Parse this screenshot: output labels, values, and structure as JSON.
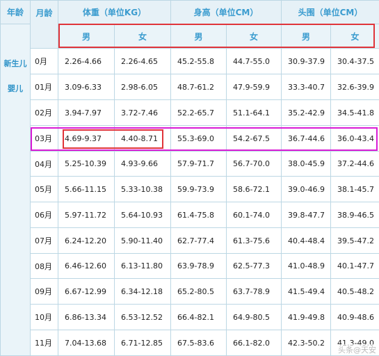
{
  "headers": {
    "age": "年龄",
    "month": "月龄",
    "weight": "体重（单位KG）",
    "height": "身高（单位CM）",
    "head": "头围（单位CM）"
  },
  "gender": {
    "male": "男",
    "female": "女"
  },
  "age_group": {
    "line1": "新生儿",
    "line2": "婴儿"
  },
  "rows": [
    {
      "month": "0月",
      "w_m": "2.26-4.66",
      "w_f": "2.26-4.65",
      "h_m": "45.2-55.8",
      "h_f": "44.7-55.0",
      "c_m": "30.9-37.9",
      "c_f": "30.4-37.5"
    },
    {
      "month": "01月",
      "w_m": "3.09-6.33",
      "w_f": "2.98-6.05",
      "h_m": "48.7-61.2",
      "h_f": "47.9-59.9",
      "c_m": "33.3-40.7",
      "c_f": "32.6-39.9"
    },
    {
      "month": "02月",
      "w_m": "3.94-7.97",
      "w_f": "3.72-7.46",
      "h_m": "52.2-65.7",
      "h_f": "51.1-64.1",
      "c_m": "35.2-42.9",
      "c_f": "34.5-41.8"
    },
    {
      "month": "03月",
      "w_m": "4.69-9.37",
      "w_f": "4.40-8.71",
      "h_m": "55.3-69.0",
      "h_f": "54.2-67.5",
      "c_m": "36.7-44.6",
      "c_f": "36.0-43.4"
    },
    {
      "month": "04月",
      "w_m": "5.25-10.39",
      "w_f": "4.93-9.66",
      "h_m": "57.9-71.7",
      "h_f": "56.7-70.0",
      "c_m": "38.0-45.9",
      "c_f": "37.2-44.6"
    },
    {
      "month": "05月",
      "w_m": "5.66-11.15",
      "w_f": "5.33-10.38",
      "h_m": "59.9-73.9",
      "h_f": "58.6-72.1",
      "c_m": "39.0-46.9",
      "c_f": "38.1-45.7"
    },
    {
      "month": "06月",
      "w_m": "5.97-11.72",
      "w_f": "5.64-10.93",
      "h_m": "61.4-75.8",
      "h_f": "60.1-74.0",
      "c_m": "39.8-47.7",
      "c_f": "38.9-46.5"
    },
    {
      "month": "07月",
      "w_m": "6.24-12.20",
      "w_f": "5.90-11.40",
      "h_m": "62.7-77.4",
      "h_f": "61.3-75.6",
      "c_m": "40.4-48.4",
      "c_f": "39.5-47.2"
    },
    {
      "month": "08月",
      "w_m": "6.46-12.60",
      "w_f": "6.13-11.80",
      "h_m": "63.9-78.9",
      "h_f": "62.5-77.3",
      "c_m": "41.0-48.9",
      "c_f": "40.1-47.7"
    },
    {
      "month": "09月",
      "w_m": "6.67-12.99",
      "w_f": "6.34-12.18",
      "h_m": "65.2-80.5",
      "h_f": "63.7-78.9",
      "c_m": "41.5-49.4",
      "c_f": "40.5-48.2"
    },
    {
      "month": "10月",
      "w_m": "6.86-13.34",
      "w_f": "6.53-12.52",
      "h_m": "66.4-82.1",
      "h_f": "64.9-80.5",
      "c_m": "41.9-49.8",
      "c_f": "40.9-48.6"
    },
    {
      "month": "11月",
      "w_m": "7.04-13.68",
      "w_f": "6.71-12.85",
      "h_m": "67.5-83.6",
      "h_f": "66.1-82.0",
      "c_m": "42.3-50.2",
      "c_f": "41.3-49.0"
    }
  ],
  "watermark": "头条@天安"
}
